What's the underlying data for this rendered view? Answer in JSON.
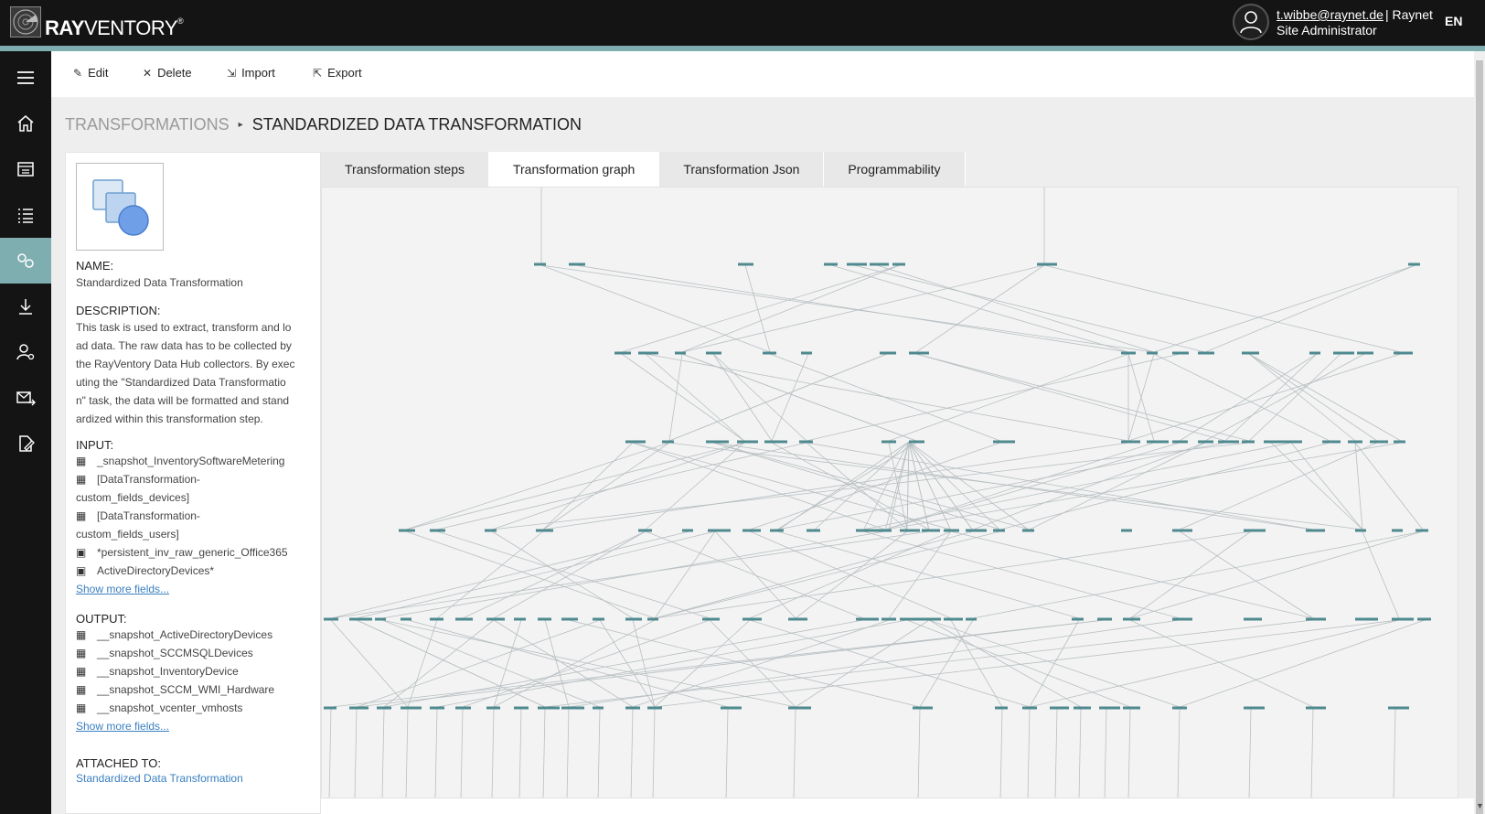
{
  "app": {
    "brand_bold": "RAY",
    "brand_thin": "VENTORY",
    "brand_mark": "®",
    "logo_icon": "radar-logo-icon"
  },
  "user": {
    "email": "t.wibbe@raynet.de",
    "company": "| Raynet",
    "role": "Site Administrator",
    "language": "EN",
    "avatar_icon": "user-avatar-icon"
  },
  "sidebar": {
    "items": [
      {
        "icon": "hamburger-menu-icon",
        "active": false
      },
      {
        "icon": "home-icon",
        "active": false
      },
      {
        "icon": "inventory-icon",
        "active": false
      },
      {
        "icon": "list-icon",
        "active": false
      },
      {
        "icon": "transformations-icon",
        "active": true
      },
      {
        "icon": "download-icon",
        "active": false
      },
      {
        "icon": "user-settings-icon",
        "active": false
      },
      {
        "icon": "mail-forward-icon",
        "active": false
      },
      {
        "icon": "document-edit-icon",
        "active": false
      }
    ]
  },
  "toolbar": {
    "edit_label": "Edit",
    "delete_label": "Delete",
    "import_label": "Import",
    "export_label": "Export"
  },
  "breadcrumb": {
    "parent": "TRANSFORMATIONS",
    "separator": "▸",
    "current": "STANDARDIZED DATA TRANSFORMATION"
  },
  "details": {
    "name_label": "NAME:",
    "name_value": "Standardized Data Transformation",
    "description_label": "DESCRIPTION:",
    "description_lines": [
      "This task is used to extract, transform and lo",
      "ad data. The raw data has to be collected by",
      "the RayVentory Data Hub collectors. By exec",
      "uting the \"Standardized Data Transformatio",
      "n\" task, the data will be formatted and stand",
      "ardized within this transformation step."
    ],
    "input_label": "INPUT:",
    "inputs": [
      {
        "icon": "table-icon",
        "line1": "_snapshot_InventorySoftwareMetering",
        "line2": ""
      },
      {
        "icon": "table-icon",
        "line1": "[DataTransformation-",
        "line2": "custom_fields_devices]"
      },
      {
        "icon": "table-icon",
        "line1": "[DataTransformation-",
        "line2": "custom_fields_users]"
      },
      {
        "icon": "archive-icon",
        "line1": "*persistent_inv_raw_generic_Office365",
        "line2": ""
      },
      {
        "icon": "archive-icon",
        "line1": "ActiveDirectoryDevices*",
        "line2": ""
      }
    ],
    "show_more_inputs": "Show more fields...",
    "output_label": "OUTPUT:",
    "outputs": [
      {
        "icon": "table-icon",
        "text": "__snapshot_ActiveDirectoryDevices"
      },
      {
        "icon": "table-icon",
        "text": "__snapshot_SCCMSQLDevices"
      },
      {
        "icon": "table-icon",
        "text": "__snapshot_InventoryDevice"
      },
      {
        "icon": "table-icon",
        "text": "__snapshot_SCCM_WMI_Hardware"
      },
      {
        "icon": "table-icon",
        "text": "__snapshot_vcenter_vmhosts"
      }
    ],
    "show_more_outputs": "Show more fields...",
    "attached_label": "ATTACHED TO:",
    "attached_value": "Standardized Data Transformation"
  },
  "tabs": [
    {
      "label": "Transformation steps",
      "active": false
    },
    {
      "label": "Transformation graph",
      "active": true
    },
    {
      "label": "Transformation Json",
      "active": false
    },
    {
      "label": "Programmability",
      "active": false
    }
  ],
  "colors": {
    "accent": "#7faeb0",
    "topbar": "#141414",
    "link": "#3a7fc0",
    "graph_node": "#4f8a8f",
    "graph_edge": "#b8bfc2"
  }
}
